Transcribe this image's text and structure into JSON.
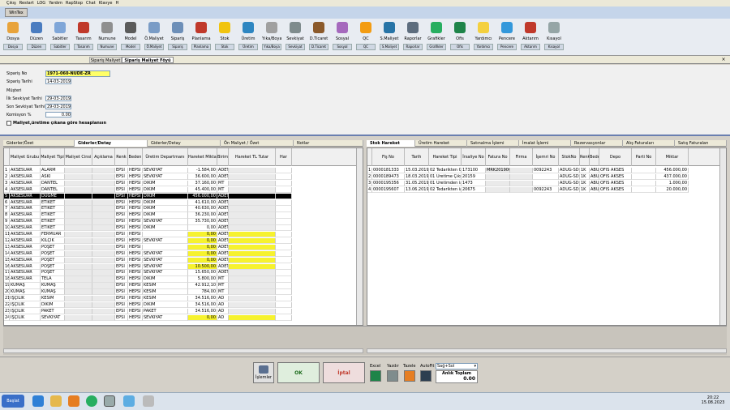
{
  "menu": [
    "Çıkış",
    "Restart",
    "LOG",
    "Yardım",
    "RapStop",
    "Chat",
    "Klavye",
    "H"
  ],
  "window_tab": "WinTex",
  "ribbon": [
    {
      "label": "Dosya",
      "drop": "Dosya",
      "color": "#e8a33b"
    },
    {
      "label": "Düzen",
      "drop": "Düzen",
      "color": "#4a7cc0"
    },
    {
      "label": "Sabitler",
      "drop": "Sabitler",
      "color": "#7fa6d8"
    },
    {
      "label": "Tasarım",
      "drop": "Tasarım",
      "color": "#c0392b"
    },
    {
      "label": "Numune",
      "drop": "Numune",
      "color": "#8f8f8f"
    },
    {
      "label": "Model",
      "drop": "Model",
      "color": "#5b5b5b"
    },
    {
      "label": "Ö.Maliyet",
      "drop": "Ö.Maliyet",
      "color": "#7a9cc6"
    },
    {
      "label": "Sipariş",
      "drop": "Sipariş",
      "color": "#6d8fb8"
    },
    {
      "label": "Planlama",
      "drop": "Planlama",
      "color": "#c0392b"
    },
    {
      "label": "Stok",
      "drop": "Stok",
      "color": "#f1c40f"
    },
    {
      "label": "Üretim",
      "drop": "Üretim",
      "color": "#2e86c1"
    },
    {
      "label": "Yıka/Boya",
      "drop": "Yıka/Boya",
      "color": "#a0a0a0"
    },
    {
      "label": "Sevkiyat",
      "drop": "Sevkiyat",
      "color": "#7f8c8d"
    },
    {
      "label": "D.Ticaret",
      "drop": "D.Ticaret",
      "color": "#8b5a2b"
    },
    {
      "label": "Sosyal",
      "drop": "Sosyal",
      "color": "#a569bd"
    },
    {
      "label": "QC",
      "drop": "QC",
      "color": "#f39c12"
    },
    {
      "label": "S.Maliyet",
      "drop": "S.Maliyet",
      "color": "#2874a6"
    },
    {
      "label": "Raporlar",
      "drop": "Raporlar",
      "color": "#5d6d7e"
    },
    {
      "label": "Grafikler",
      "drop": "Grafikler",
      "color": "#27ae60"
    },
    {
      "label": "Ofis",
      "drop": "Ofis",
      "color": "#1e8449"
    },
    {
      "label": "Yardımcı",
      "drop": "Yardımcı",
      "color": "#f4d03f"
    },
    {
      "label": "Pencere",
      "drop": "Pencere",
      "color": "#3498db"
    },
    {
      "label": "Aktarım",
      "drop": "Aktarım",
      "color": "#c0392b"
    },
    {
      "label": "Kısayol",
      "drop": "Kısayol",
      "color": "#95a5a6"
    }
  ],
  "doc_tabs": [
    "Sipariş Maliyet",
    "Sipariş Maliyet Föyü"
  ],
  "form": {
    "siparis_no_label": "Sipariş No",
    "siparis_no": "1971-060-NUDE-ZR",
    "siparis_tarihi_label": "Sipariş Tarihi",
    "siparis_tarihi": "14-03-2019",
    "musteri_label": "Müşteri",
    "ilk_sevk_label": "İlk Sevkiyat Tarihi",
    "ilk_sevk": "29-03-2019",
    "son_sevk_label": "Son Sevkiyat Tarihi",
    "son_sevk": "29-03-2019",
    "komisyon_label": "Komisyon %",
    "komisyon": "0.00",
    "check_label": "Maliyet,üretime çıkana göre hesaplansın"
  },
  "left_tabs": [
    "Giderler/Özet",
    "Giderler/Detay",
    "Giderler/Detay",
    "Ön Maliyet / Özet",
    "Notlar"
  ],
  "left_columns": [
    "Maliyet Grubu",
    "Maliyet Tipi",
    "Maliyet Cinsi",
    "Açıklama",
    "Renk",
    "Beden",
    "Üretim Departmanı",
    "Hareket Miktarı",
    "Birim",
    "Hareket TL Tutar",
    "Har"
  ],
  "left_rows": [
    [
      "1",
      "AKSESUAR",
      "ALARM",
      "",
      "",
      "EPSI",
      "HEPSI",
      "SEVKİYAT",
      "-1.584,00",
      "ADET"
    ],
    [
      "2",
      "AKSESUAR",
      "ASKI",
      "",
      "",
      "EPSI",
      "HEPSI",
      "SEVKİYAT",
      "36.600,00",
      "ADET"
    ],
    [
      "3",
      "AKSESUAR",
      "DANTEL",
      "",
      "",
      "EPSI",
      "HEPSI",
      "DİKİM",
      "37.160,00",
      "MT"
    ],
    [
      "4",
      "AKSESUAR",
      "DANTEL",
      "",
      "",
      "EPSI",
      "HEPSI",
      "DİKİM",
      "45.400,00",
      "MT"
    ],
    [
      "5",
      "AKSESUAR",
      "DÜĞME",
      "",
      "",
      "EPSI",
      "HEPSI",
      "DİKİM",
      "456.000,00",
      "ADET"
    ],
    [
      "6",
      "AKSESUAR",
      "ETİKET",
      "",
      "",
      "EPSI",
      "HEPSI",
      "DİKİM",
      "41.610,00",
      "ADET"
    ],
    [
      "7",
      "AKSESUAR",
      "ETİKET",
      "",
      "",
      "EPSI",
      "HEPSI",
      "DİKİM",
      "40.630,00",
      "ADET"
    ],
    [
      "8",
      "AKSESUAR",
      "ETİKET",
      "",
      "",
      "EPSI",
      "HEPSI",
      "DİKİM",
      "36.230,00",
      "ADET"
    ],
    [
      "9",
      "AKSESUAR",
      "ETİKET",
      "",
      "",
      "EPSI",
      "HEPSI",
      "SEVKİYAT",
      "35.730,00",
      "ADET"
    ],
    [
      "10",
      "AKSESUAR",
      "ETİKET",
      "",
      "",
      "EPSI",
      "HEPSI",
      "DİKİM",
      "0,00",
      "ADET"
    ],
    [
      "11",
      "AKSESUAR",
      "FERMUAR",
      "",
      "",
      "EPSI",
      "HEPSI",
      "",
      "0,00",
      "ADET"
    ],
    [
      "12",
      "AKSESUAR",
      "KILÇIK",
      "",
      "",
      "EPSI",
      "HEPSI",
      "SEVKİYAT",
      "0,00",
      "ADET"
    ],
    [
      "13",
      "AKSESUAR",
      "POŞET",
      "",
      "",
      "EPSI",
      "HEPSI",
      "",
      "0,00",
      "ADET"
    ],
    [
      "14",
      "AKSESUAR",
      "POŞET",
      "",
      "",
      "EPSI",
      "HEPSI",
      "SEVKİYAT",
      "0,00",
      "ADET"
    ],
    [
      "15",
      "AKSESUAR",
      "POŞET",
      "",
      "",
      "EPSI",
      "HEPSI",
      "SEVKİYAT",
      "0,00",
      "ADET"
    ],
    [
      "16",
      "AKSESUAR",
      "POŞET",
      "",
      "",
      "EPSI",
      "HEPSI",
      "SEVKİYAT",
      "10.500,00",
      "ADET"
    ],
    [
      "17",
      "AKSESUAR",
      "POŞET",
      "",
      "",
      "EPSI",
      "HEPSI",
      "SEVKİYAT",
      "15.650,00",
      "ADET"
    ],
    [
      "18",
      "AKSESUAR",
      "TELA",
      "",
      "",
      "EPSI",
      "HEPSI",
      "DİKİM",
      "5.800,00",
      "MT"
    ],
    [
      "19",
      "KUMAŞ",
      "KUMAŞ",
      "",
      "",
      "EPSI",
      "HEPSI",
      "KESİM",
      "42.912,10",
      "MT"
    ],
    [
      "20",
      "KUMAŞ",
      "KUMAŞ",
      "",
      "",
      "EPSI",
      "HEPSI",
      "KESİM",
      "784,00",
      "MT"
    ],
    [
      "21",
      "İŞÇİLİK",
      "KESİM",
      "",
      "",
      "EPSI",
      "HEPSI",
      "KESİM",
      "34.516,00",
      "AD"
    ],
    [
      "22",
      "İŞÇİLİK",
      "DİKİM",
      "",
      "",
      "EPSI",
      "HEPSI",
      "DİKİM",
      "34.516,00",
      "AD"
    ],
    [
      "23",
      "İŞÇİLİK",
      "PAKET",
      "",
      "",
      "EPSI",
      "HEPSI",
      "PAKET",
      "34.516,00",
      "AD"
    ],
    [
      "24",
      "İŞÇİLİK",
      "SEVKİYAT",
      "",
      "",
      "EPSI",
      "HEPSI",
      "SEVKİYAT",
      "0,00",
      "AD"
    ]
  ],
  "right_tabs": [
    "Stok Hareket",
    "Üretim Hareket",
    "Satınalma İşlemi",
    "İmalat İşlemi",
    "Rezervasyonlar",
    "Alış Faturaları",
    "Satış Faturaları"
  ],
  "right_columns": [
    "Fiş No",
    "Tarih",
    "Hareket Tipi",
    "İrsaliye No",
    "Fatura No",
    "Firma",
    "İşemri No",
    "StokNo",
    "Renk",
    "Beden",
    "Depo",
    "Parti No",
    "Miktar"
  ],
  "right_rows": [
    [
      "1",
      "0000181333",
      "15.03.2019",
      "02 Tedarikten Giri",
      "173100",
      "MRK201900",
      "",
      "0092243",
      "ADUG-SDF",
      "1K",
      "ABUK",
      "OFIS AKSES",
      "",
      "456.000,00"
    ],
    [
      "2",
      "0000189473",
      "18.03.2019",
      "01 Üretime Çıkış",
      "20159",
      "",
      "",
      "",
      "ADUG-SDF",
      "1K",
      "ABUK",
      "OFIS AKSES",
      "",
      "437.000,00"
    ],
    [
      "3",
      "0000195356",
      "31.05.2019",
      "01 Üretimden iade",
      "1473",
      "",
      "",
      "",
      "ADUG-SDF",
      "1K",
      "ABUK",
      "OFIS AKSES",
      "",
      "1.000,00"
    ],
    [
      "4",
      "0000195607",
      "13.06.2019",
      "02 Tedarikten iade",
      "20675",
      "",
      "",
      "0092243",
      "ADUG-SDF",
      "1K",
      "ABUK",
      "OFIS AKSES",
      "",
      "20.000,00"
    ]
  ],
  "bottom": {
    "islemler": "İşlemler",
    "ok": "OK",
    "iptal": "İptal",
    "excel": "Excel",
    "yazdir": "Yazdır",
    "tazele": "Tazele",
    "autofit": "AutoFit",
    "combo": "Sağ+Sol",
    "aniki_label": "Anlık Toplam",
    "aniki_value": "0.00"
  },
  "taskbar": {
    "start": "Başlat",
    "time": "20:22",
    "date": "15.08.2023"
  }
}
